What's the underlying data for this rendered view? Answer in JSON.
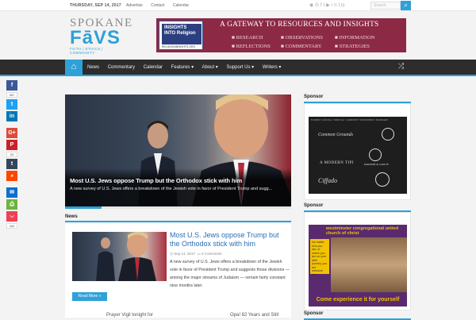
{
  "topbar": {
    "date": "THURSDAY, SEP 14, 2017",
    "links": [
      "Advertise",
      "Contact",
      "Calendar"
    ],
    "social_icons": [
      "rss-icon",
      "google-plus-icon",
      "facebook-icon",
      "twitter-icon",
      "youtube-icon",
      "linkedin-icon",
      "tumblr-icon",
      "instagram-icon"
    ],
    "search_placeholder": "Search"
  },
  "logo": {
    "line1": "SPOKANE",
    "line2": "FāVS",
    "line3": "FAITH | ETHICS | COMMUNITY"
  },
  "banner": {
    "box_title": "INSIGHTS INTO Religion",
    "box_url": "RELIGIONINSIGHTS.ORG",
    "tagline": "A GATEWAY TO RESOURCES AND INSIGHTS",
    "items": [
      "RESEARCH",
      "OBSERVATIONS",
      "INFORMATION",
      "REFLECTIONS",
      "COMMENTARY",
      "STRATEGIES"
    ]
  },
  "nav": {
    "items": [
      "News",
      "Commentary",
      "Calendar",
      "Features ▾",
      "About ▾",
      "Support Us ▾",
      "Writers ▾"
    ]
  },
  "share": {
    "fb_count": "387",
    "pin_count": "53",
    "total_count": "440"
  },
  "hero": {
    "title": "Most U.S. Jews oppose Trump but the Orthodox stick with him",
    "excerpt": "A new survey of U.S. Jews offers a breakdown of the Jewish vote in favor of President Trump and sugg..."
  },
  "news": {
    "heading": "News",
    "title": "Most U.S. Jews oppose Trump but the Orthodox stick with him",
    "date": "Sep 14, 2017",
    "comments": "0 Comments",
    "excerpt": "A new survey of U.S. Jews offers a breakdown of the Jewish vote in favor of President Trump and suggests those divisions — among the major streams of Judaism — remain fairly constant nine months later.",
    "more": "Read More »",
    "prev": "Prayer Vigil tonight for",
    "next": "Opa! 82 Years and Still"
  },
  "sidebar": {
    "sponsor_heading": "Sponsor",
    "board": {
      "top_row": "FLEXIBLE • NATURAL • SPIRITUAL • COMMUNITY • RESPONSIBLE • HANDMADE",
      "n1": "Common Grounds",
      "n2": "A MODERN TIPI",
      "n3": "PARRISH & GROVE",
      "n4": "Ciffado"
    },
    "ad": {
      "header": "westminster congregational united church of christ",
      "side": "No matter who you are, or where you are on your faith journey, you are welcome here",
      "foot": "Come experience it for yourself"
    }
  }
}
